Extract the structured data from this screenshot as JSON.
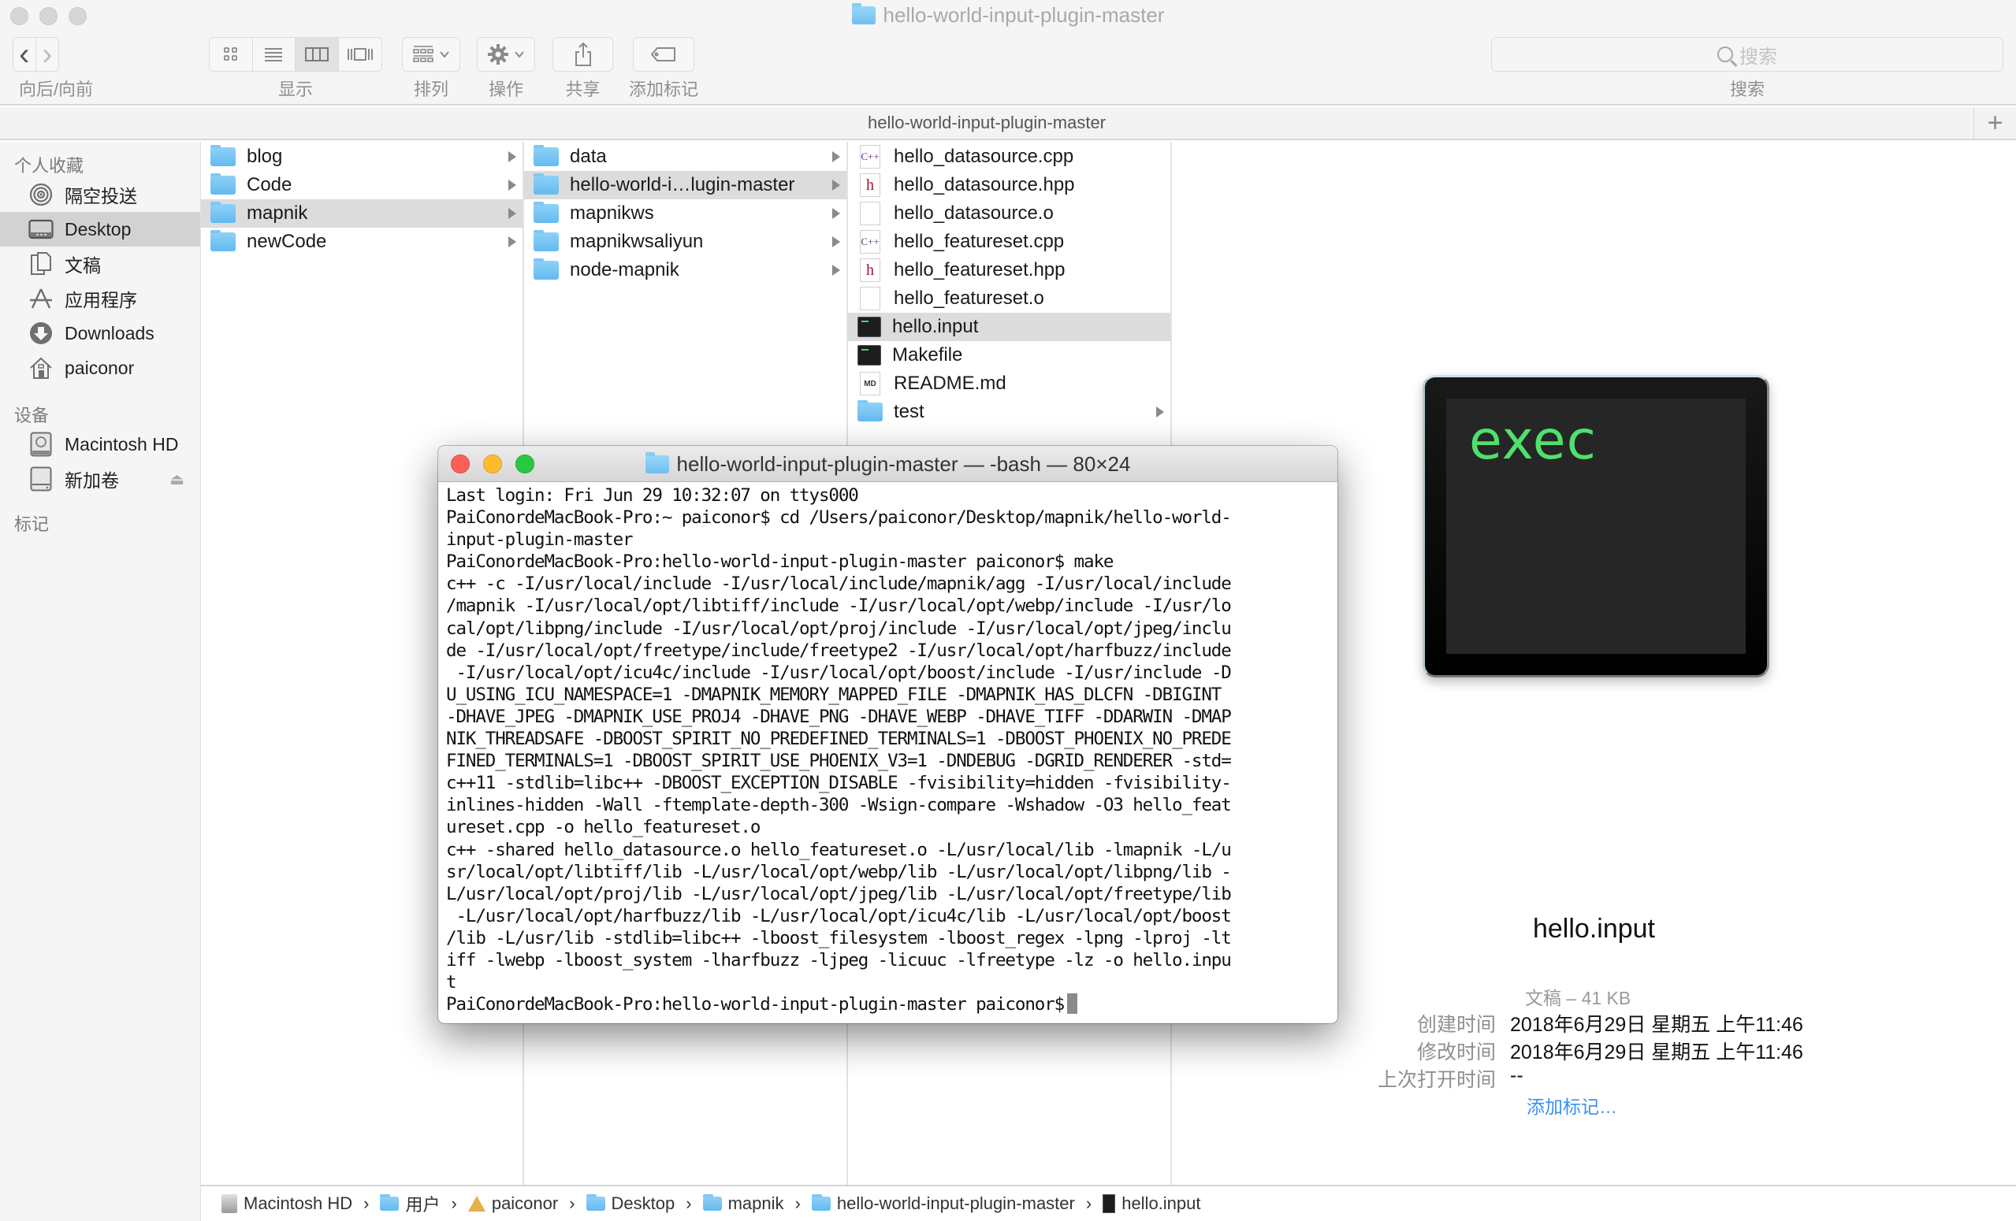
{
  "window": {
    "title": "hello-world-input-plugin-master",
    "tab_title": "hello-world-input-plugin-master",
    "tab_add_label": "+"
  },
  "toolbar": {
    "nav_label": "向后/向前",
    "view_label": "显示",
    "arrange_label": "排列",
    "action_label": "操作",
    "share_label": "共享",
    "tags_label": "添加标记",
    "search_placeholder": "搜索",
    "search_label": "搜索",
    "back_glyph": "‹",
    "forward_glyph": "›",
    "view_modes": [
      "icon",
      "list",
      "column",
      "cover-flow"
    ],
    "active_view_mode": "column"
  },
  "sidebar": {
    "favorites_heading": "个人收藏",
    "devices_heading": "设备",
    "tags_heading": "标记",
    "favorites": [
      {
        "label": "隔空投送",
        "icon": "airdrop-icon",
        "selected": false
      },
      {
        "label": "Desktop",
        "icon": "desktop-icon",
        "selected": true
      },
      {
        "label": "文稿",
        "icon": "documents-icon",
        "selected": false
      },
      {
        "label": "应用程序",
        "icon": "applications-icon",
        "selected": false
      },
      {
        "label": "Downloads",
        "icon": "downloads-icon",
        "selected": false
      },
      {
        "label": "paiconor",
        "icon": "home-icon",
        "selected": false
      }
    ],
    "devices": [
      {
        "label": "Macintosh HD",
        "icon": "hard-drive-icon",
        "ejectable": false
      },
      {
        "label": "新加卷",
        "icon": "external-drive-icon",
        "ejectable": true
      }
    ]
  },
  "columns": [
    {
      "items": [
        {
          "name": "blog",
          "kind": "folder",
          "selected": false
        },
        {
          "name": "Code",
          "kind": "folder",
          "selected": false
        },
        {
          "name": "mapnik",
          "kind": "folder",
          "selected": true
        },
        {
          "name": "newCode",
          "kind": "folder",
          "selected": false
        }
      ]
    },
    {
      "items": [
        {
          "name": "data",
          "kind": "folder",
          "selected": false
        },
        {
          "name": "hello-world-i…lugin-master",
          "kind": "folder",
          "selected": true
        },
        {
          "name": "mapnikws",
          "kind": "folder",
          "selected": false
        },
        {
          "name": "mapnikwsaliyun",
          "kind": "folder",
          "selected": false
        },
        {
          "name": "node-mapnik",
          "kind": "folder",
          "selected": false
        }
      ]
    },
    {
      "items": [
        {
          "name": "hello_datasource.cpp",
          "kind": "cpp",
          "selected": false
        },
        {
          "name": "hello_datasource.hpp",
          "kind": "h",
          "selected": false
        },
        {
          "name": "hello_datasource.o",
          "kind": "blank",
          "selected": false
        },
        {
          "name": "hello_featureset.cpp",
          "kind": "cpp",
          "selected": false
        },
        {
          "name": "hello_featureset.hpp",
          "kind": "h",
          "selected": false
        },
        {
          "name": "hello_featureset.o",
          "kind": "blank",
          "selected": false
        },
        {
          "name": "hello.input",
          "kind": "exec",
          "selected": true
        },
        {
          "name": "Makefile",
          "kind": "exec",
          "selected": false
        },
        {
          "name": "README.md",
          "kind": "md",
          "selected": false
        },
        {
          "name": "test",
          "kind": "folder",
          "selected": false
        }
      ]
    }
  ],
  "file_badges": {
    "cpp": "C++",
    "h": "h",
    "md": "MD"
  },
  "preview": {
    "icon_text": "exec",
    "name": "hello.input",
    "kind_size": "文稿 – 41 KB",
    "rows": [
      {
        "key": "创建时间",
        "value": "2018年6月29日 星期五 上午11:46"
      },
      {
        "key": "修改时间",
        "value": "2018年6月29日 星期五 上午11:46"
      },
      {
        "key": "上次打开时间",
        "value": "--"
      }
    ],
    "add_tags_link": "添加标记…"
  },
  "pathbar": {
    "separator": "›",
    "crumbs": [
      {
        "label": "Macintosh HD",
        "icon": "hd"
      },
      {
        "label": "用户",
        "icon": "folder"
      },
      {
        "label": "paiconor",
        "icon": "home"
      },
      {
        "label": "Desktop",
        "icon": "folder"
      },
      {
        "label": "mapnik",
        "icon": "folder"
      },
      {
        "label": "hello-world-input-plugin-master",
        "icon": "folder"
      },
      {
        "label": "hello.input",
        "icon": "exec"
      }
    ]
  },
  "terminal": {
    "title": "hello-world-input-plugin-master — -bash — 80×24",
    "lines": [
      "Last login: Fri Jun 29 10:32:07 on ttys000",
      "PaiConordeMacBook-Pro:~ paiconor$ cd /Users/paiconor/Desktop/mapnik/hello-world-",
      "input-plugin-master",
      "PaiConordeMacBook-Pro:hello-world-input-plugin-master paiconor$ make",
      "c++ -c -I/usr/local/include -I/usr/local/include/mapnik/agg -I/usr/local/include",
      "/mapnik -I/usr/local/opt/libtiff/include -I/usr/local/opt/webp/include -I/usr/lo",
      "cal/opt/libpng/include -I/usr/local/opt/proj/include -I/usr/local/opt/jpeg/inclu",
      "de -I/usr/local/opt/freetype/include/freetype2 -I/usr/local/opt/harfbuzz/include",
      " -I/usr/local/opt/icu4c/include -I/usr/local/opt/boost/include -I/usr/include -D",
      "U_USING_ICU_NAMESPACE=1 -DMAPNIK_MEMORY_MAPPED_FILE -DMAPNIK_HAS_DLCFN -DBIGINT",
      "-DHAVE_JPEG -DMAPNIK_USE_PROJ4 -DHAVE_PNG -DHAVE_WEBP -DHAVE_TIFF -DDARWIN -DMAP",
      "NIK_THREADSAFE -DBOOST_SPIRIT_NO_PREDEFINED_TERMINALS=1 -DBOOST_PHOENIX_NO_PREDE",
      "FINED_TERMINALS=1 -DBOOST_SPIRIT_USE_PHOENIX_V3=1 -DNDEBUG -DGRID_RENDERER -std=",
      "c++11 -stdlib=libc++ -DBOOST_EXCEPTION_DISABLE -fvisibility=hidden -fvisibility-",
      "inlines-hidden -Wall -ftemplate-depth-300 -Wsign-compare -Wshadow -O3 hello_feat",
      "ureset.cpp -o hello_featureset.o",
      "c++ -shared hello_datasource.o hello_featureset.o -L/usr/local/lib -lmapnik -L/u",
      "sr/local/opt/libtiff/lib -L/usr/local/opt/webp/lib -L/usr/local/opt/libpng/lib -",
      "L/usr/local/opt/proj/lib -L/usr/local/opt/jpeg/lib -L/usr/local/opt/freetype/lib",
      " -L/usr/local/opt/harfbuzz/lib -L/usr/local/opt/icu4c/lib -L/usr/local/opt/boost",
      "/lib -L/usr/lib -stdlib=libc++ -lboost_filesystem -lboost_regex -lpng -lproj -lt",
      "iff -lwebp -lboost_system -lharfbuzz -ljpeg -licuuc -lfreetype -lz -o hello.inpu",
      "t"
    ],
    "prompt": "PaiConordeMacBook-Pro:hello-world-input-plugin-master paiconor$"
  },
  "colors": {
    "close": "#fc5f57",
    "minimize": "#fdbc2e",
    "maximize": "#28c840",
    "exec_green": "#4ee16d",
    "link_blue": "#3a8ff0",
    "selection_gray": "#dcdcdc"
  }
}
